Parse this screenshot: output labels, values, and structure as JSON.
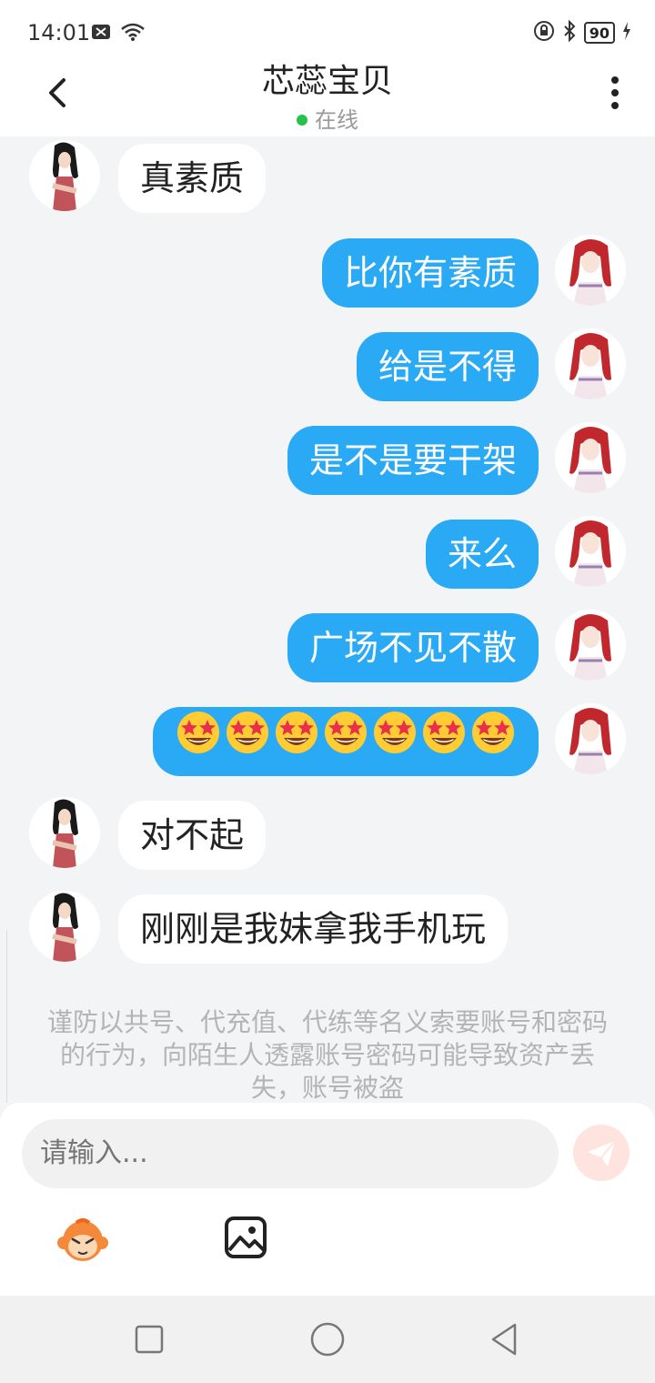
{
  "status_bar": {
    "time": "14:01",
    "battery": "90"
  },
  "header": {
    "title": "芯蕊宝贝",
    "status": "在线"
  },
  "messages": [
    {
      "side": "in",
      "text": "真素质"
    },
    {
      "side": "out",
      "text": "比你有素质"
    },
    {
      "side": "out",
      "text": "给是不得"
    },
    {
      "side": "out",
      "text": "是不是要干架"
    },
    {
      "side": "out",
      "text": "来么"
    },
    {
      "side": "out",
      "text": "广场不见不散"
    },
    {
      "side": "out",
      "emoji": "star-struck",
      "count": 7
    },
    {
      "side": "in",
      "text": "对不起"
    },
    {
      "side": "in",
      "text": "刚刚是我妹拿我手机玩"
    }
  ],
  "notice": "谨防以共号、代充值、代练等名义索要账号和密码的行为，向陌生人透露账号密码可能导致资产丢失，账号被盗",
  "input": {
    "placeholder": "请输入..."
  },
  "colors": {
    "bubble_out": "#2aa9f5",
    "bubble_in": "#ffffff",
    "online": "#27c24c",
    "send": "#ffe3de"
  }
}
